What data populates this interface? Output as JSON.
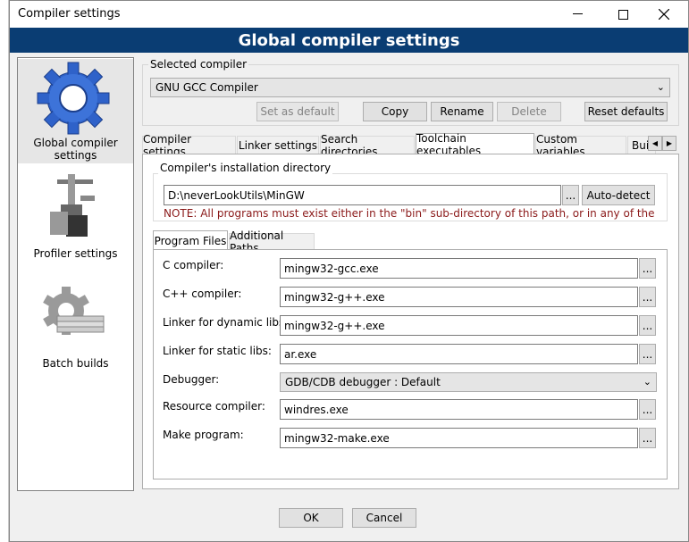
{
  "window": {
    "title": "Compiler settings",
    "minimize_icon": "minimize-icon",
    "maximize_icon": "maximize-icon",
    "close_icon": "close-icon"
  },
  "banner": "Global compiler settings",
  "nav": [
    {
      "label": "Global compiler settings",
      "icon": "gear-icon",
      "selected": true
    },
    {
      "label": "Profiler settings",
      "icon": "profiler-icon",
      "selected": false
    },
    {
      "label": "Batch builds",
      "icon": "batch-gear-icon",
      "selected": false
    }
  ],
  "selected_compiler": {
    "legend": "Selected compiler",
    "value": "GNU GCC Compiler",
    "buttons": {
      "set_default": "Set as default",
      "copy": "Copy",
      "rename": "Rename",
      "delete": "Delete",
      "reset": "Reset defaults"
    }
  },
  "tabs": [
    "Compiler settings",
    "Linker settings",
    "Search directories",
    "Toolchain executables",
    "Custom variables",
    "Bui"
  ],
  "install_dir": {
    "legend": "Compiler's installation directory",
    "path": "D:\\neverLookUtils\\MinGW",
    "browse": "...",
    "autodetect": "Auto-detect",
    "note": "NOTE: All programs must exist either in the \"bin\" sub-directory of this path, or in any of the"
  },
  "subtabs": [
    "Program Files",
    "Additional Paths"
  ],
  "programs": [
    {
      "label": "C compiler:",
      "value": "mingw32-gcc.exe"
    },
    {
      "label": "C++ compiler:",
      "value": "mingw32-g++.exe"
    },
    {
      "label": "Linker for dynamic libs:",
      "value": "mingw32-g++.exe"
    },
    {
      "label": "Linker for static libs:",
      "value": "ar.exe"
    }
  ],
  "debugger": {
    "label": "Debugger:",
    "value": "GDB/CDB debugger : Default"
  },
  "programs2": [
    {
      "label": "Resource compiler:",
      "value": "windres.exe"
    },
    {
      "label": "Make program:",
      "value": "mingw32-make.exe"
    }
  ],
  "browse_label": "...",
  "footer": {
    "ok": "OK",
    "cancel": "Cancel"
  }
}
